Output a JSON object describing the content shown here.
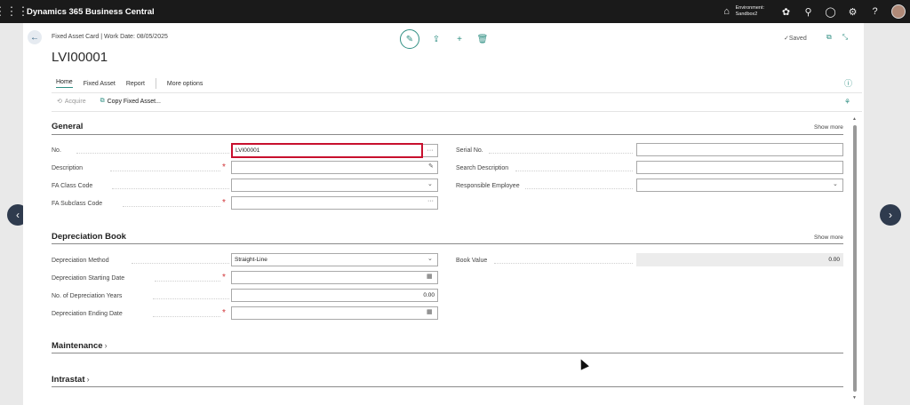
{
  "topbar": {
    "app_title": "Dynamics 365 Business Central",
    "environment_line1": "Environment:",
    "environment_line2": "Sandbox2",
    "icons": [
      "app-launcher-icon",
      "environment-icon",
      "copilot-icon",
      "search-icon",
      "notifications-icon",
      "settings-icon",
      "help-icon",
      "avatar"
    ]
  },
  "page": {
    "caption": "Fixed Asset Card | Work Date: 08/05/2025",
    "title": "LVI00001",
    "saved_label": "Saved",
    "header_icons": [
      "edit-icon",
      "share-icon",
      "new-icon",
      "delete-icon"
    ]
  },
  "action_tabs": {
    "home": "Home",
    "fixed_asset": "Fixed Asset",
    "report": "Report",
    "more_options": "More options"
  },
  "actions": {
    "acquire": "Acquire",
    "copy_fixed_asset": "Copy Fixed Asset..."
  },
  "general": {
    "title": "General",
    "show_more": "Show more",
    "fields": {
      "no": {
        "label": "No.",
        "value": "LVI00001"
      },
      "description": {
        "label": "Description",
        "value": ""
      },
      "fa_class_code": {
        "label": "FA Class Code",
        "value": ""
      },
      "fa_subclass_code": {
        "label": "FA Subclass Code",
        "value": ""
      },
      "serial_no": {
        "label": "Serial No.",
        "value": ""
      },
      "search_description": {
        "label": "Search Description",
        "value": ""
      },
      "responsible_employee": {
        "label": "Responsible Employee",
        "value": ""
      }
    }
  },
  "depreciation": {
    "title": "Depreciation Book",
    "show_more": "Show more",
    "fields": {
      "method": {
        "label": "Depreciation Method",
        "value": "Straight-Line"
      },
      "starting_date": {
        "label": "Depreciation Starting Date",
        "value": ""
      },
      "years": {
        "label": "No. of Depreciation Years",
        "value": "0.00"
      },
      "ending_date": {
        "label": "Depreciation Ending Date",
        "value": ""
      },
      "book_value": {
        "label": "Book Value",
        "value": "0.00"
      }
    }
  },
  "maintenance": {
    "title": "Maintenance"
  },
  "intrastat": {
    "title": "Intrastat"
  },
  "colors": {
    "accent": "#2f8f83",
    "required": "#d13438",
    "focus_border": "#c8102e",
    "topbar": "#1a1a1a"
  }
}
